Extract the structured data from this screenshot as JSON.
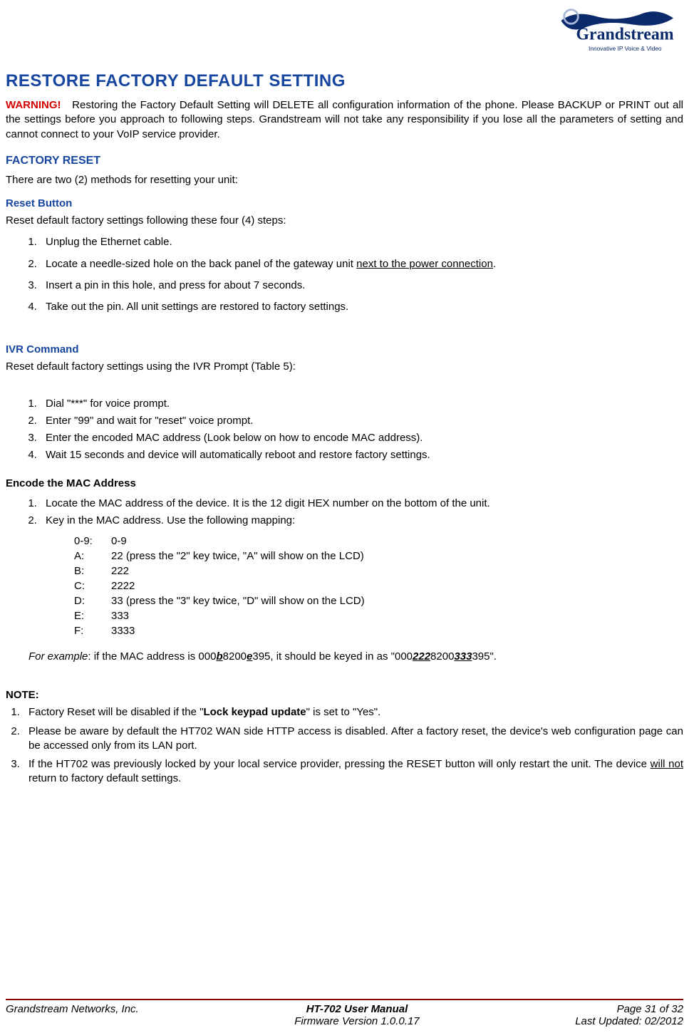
{
  "header": {
    "logo_text": "Grandstream",
    "logo_tagline": "Innovative IP Voice & Video"
  },
  "title": "RESTORE FACTORY DEFAULT SETTING",
  "warning": {
    "label": "WARNING!",
    "text": "Restoring the Factory Default Setting will DELETE all configuration information of the phone. Please BACKUP or PRINT out all the settings before you approach to following steps. Grandstream will not take any responsibility if you lose all the parameters of setting and cannot connect to your VoIP service provider."
  },
  "factory_reset": {
    "heading": "FACTORY RESET",
    "intro": "There are two (2) methods for resetting your unit:"
  },
  "reset_button": {
    "heading": "Reset Button",
    "intro": "Reset default factory settings following these four (4) steps:",
    "steps": [
      "Unplug the Ethernet cable.",
      "Locate a needle-sized hole on the back panel of the gateway unit ",
      "Insert a pin in this hole, and press for about 7 seconds.",
      "Take out the pin.  All unit settings are restored to factory settings."
    ],
    "step2_underline": "next to the power connection"
  },
  "ivr": {
    "heading": "IVR Command",
    "intro": "Reset default factory settings using the IVR Prompt (Table 5):",
    "steps": [
      "Dial \"***\" for voice prompt.",
      "Enter \"99\" and wait for \"reset\" voice prompt.",
      "Enter the encoded MAC address (Look below on how to encode MAC address).",
      "Wait 15 seconds and device will automatically reboot and restore factory settings."
    ]
  },
  "encode": {
    "heading": "Encode the MAC Address",
    "steps": {
      "s1": "Locate the MAC address of the device.  It is the 12 digit HEX number on the bottom of the unit.",
      "s2": "Key in the MAC address.  Use the following mapping:"
    },
    "mapping": [
      {
        "k": "0-9:",
        "v": "0-9"
      },
      {
        "k": "A:",
        "v": "22  (press the \"2\" key twice, \"A\" will show on the LCD)"
      },
      {
        "k": "B:",
        "v": "222"
      },
      {
        "k": "C:",
        "v": "2222"
      },
      {
        "k": "D:",
        "v": "33  (press the \"3\" key twice, \"D\" will show on the LCD)"
      },
      {
        "k": "E:",
        "v": "333"
      },
      {
        "k": "F:",
        "v": "3333"
      }
    ],
    "example": {
      "label": "For example",
      "pre": ":  if the MAC address is 000",
      "b": "b",
      "mid1": "8200",
      "e": "e",
      "mid2": "395, it should be keyed in as \"000",
      "b_enc": "222",
      "mid3": "8200",
      "e_enc": "333",
      "post": "395\"."
    }
  },
  "note": {
    "heading": "NOTE:",
    "n1_pre": "Factory Reset will be disabled if the \"",
    "n1_bold": "Lock keypad update",
    "n1_post": "\" is set to \"Yes\".",
    "n2": "Please be aware by default the HT702 WAN side HTTP access is disabled. After a factory reset, the device's web configuration page can be accessed only from its LAN port.",
    "n3_pre": "If the HT702 was previously locked by your local service provider, pressing the RESET button will only restart the unit.  The device ",
    "n3_underline": "will not",
    "n3_post": " return to factory default settings."
  },
  "footer": {
    "left": "Grandstream Networks, Inc.",
    "center1": "HT-702 User Manual",
    "center2": "Firmware Version 1.0.0.17",
    "right1": "Page 31 of 32",
    "right2": "Last Updated: 02/2012"
  }
}
